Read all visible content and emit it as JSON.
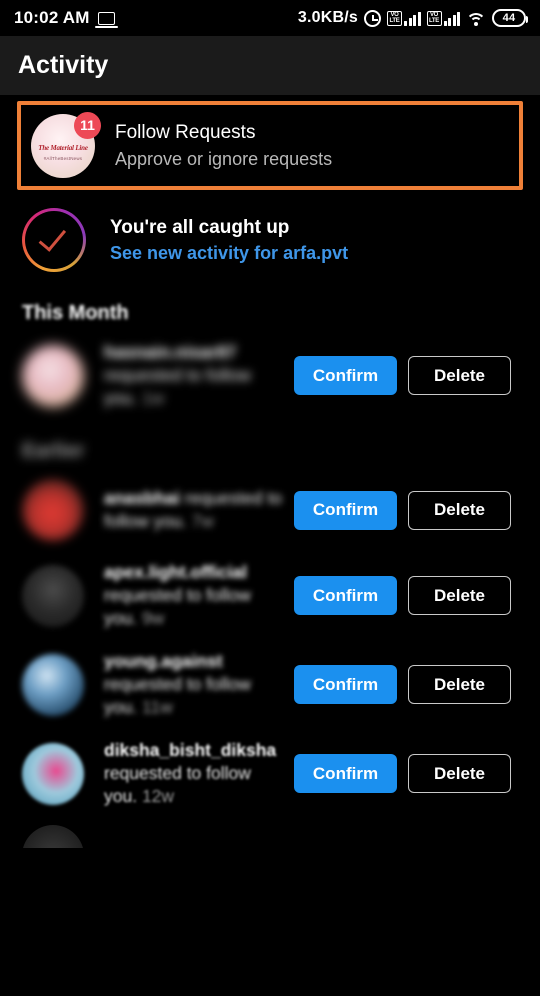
{
  "statusbar": {
    "time": "10:02 AM",
    "cast_icon": "laptop-icon",
    "network_speed": "3.0KB/s",
    "alarm_icon": "alarm-clock-icon",
    "sim1_volte_line1": "VO",
    "sim1_volte_line2": "LTE",
    "sim2_volte_line1": "VO",
    "sim2_volte_line2": "LTE",
    "wifi_icon": "wifi-icon",
    "battery_level": "44"
  },
  "header": {
    "title": "Activity"
  },
  "follow_requests": {
    "title": "Follow Requests",
    "subtitle": "Approve or ignore requests",
    "badge_count": "11",
    "avatar_logo_line1": "The Material Line",
    "avatar_logo_line2": "#AllTheBestNews",
    "highlight_color": "#ef8038"
  },
  "caught_up": {
    "title": "You're all caught up",
    "link": "See new activity for arfa.pvt",
    "link_color": "#3f96e8",
    "check_icon": "gradient-check-circle-icon"
  },
  "sections": [
    {
      "label": "This Month"
    },
    {
      "label": "Earlier"
    }
  ],
  "buttons": {
    "confirm_label": "Confirm",
    "delete_label": "Delete",
    "confirm_color": "#1b90ef"
  },
  "requests": [
    {
      "username": "hasnain.nisar87",
      "action": "requested to follow",
      "suffix": "you.",
      "timestamp": "1w"
    },
    {
      "username": "anasbhai",
      "action": "requested to follow",
      "suffix": "you.",
      "timestamp": "7w"
    },
    {
      "username": "apex.light.official",
      "action": "requested to follow",
      "suffix": "you.",
      "timestamp": "9w"
    },
    {
      "username": "young.against",
      "action": "requested to follow",
      "suffix": "you.",
      "timestamp": "11w"
    },
    {
      "username": "diksha_bisht_diksha",
      "action": "requested to follow",
      "suffix": "you.",
      "timestamp": "12w"
    }
  ]
}
